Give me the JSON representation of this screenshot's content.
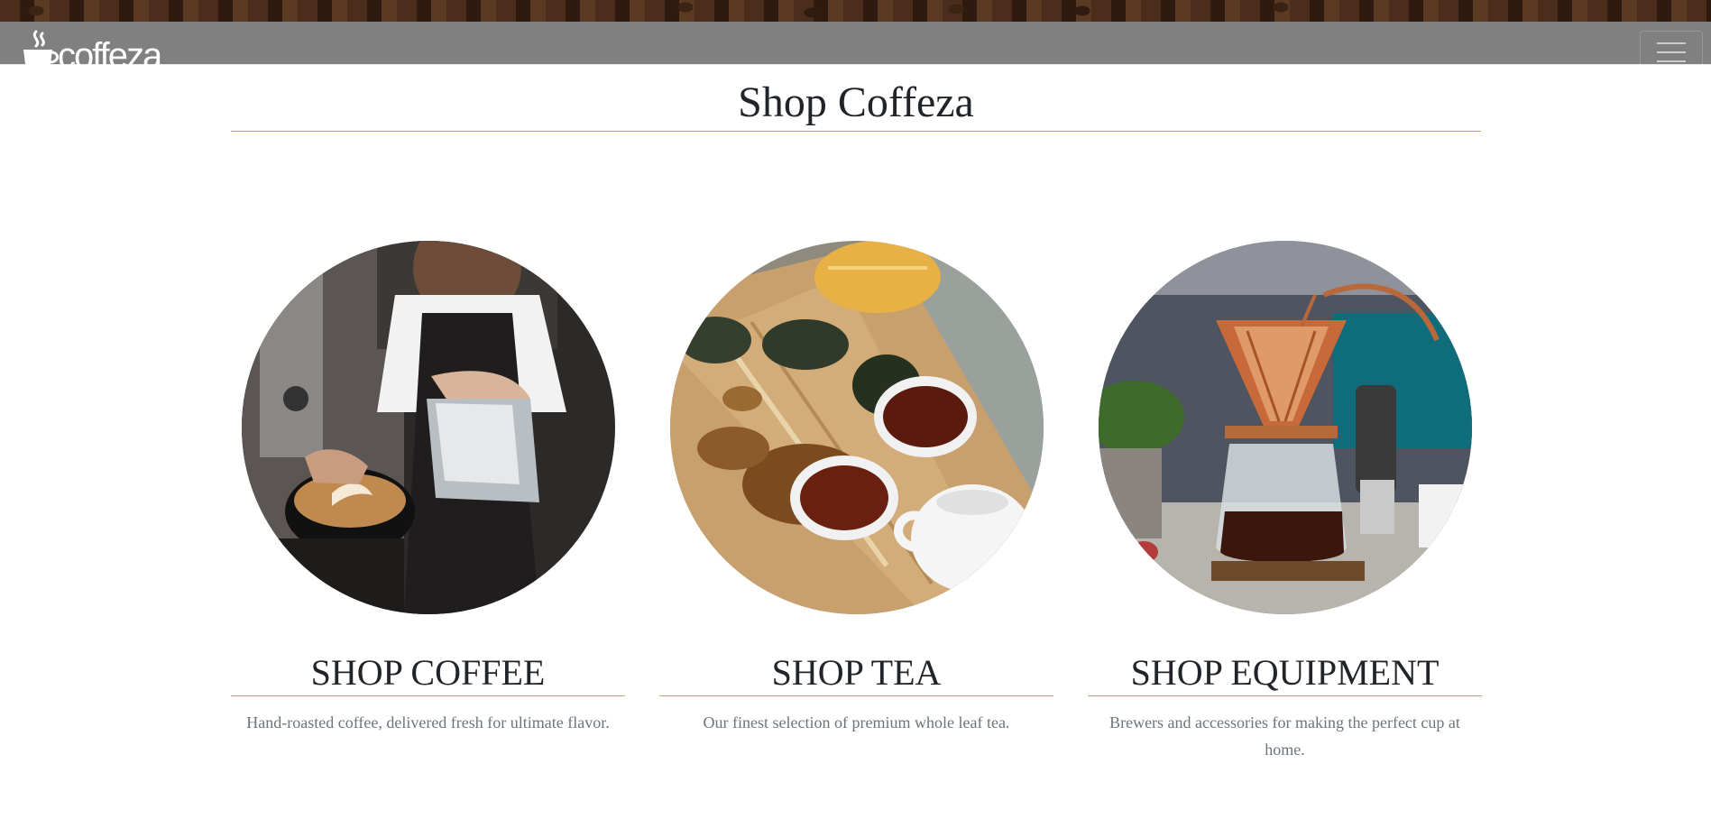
{
  "navbar": {
    "logo_text": "coffeza",
    "menu_icon": "hamburger-icon"
  },
  "page": {
    "title": "Shop Coffeza"
  },
  "cards": [
    {
      "title": "SHOP COFFEE",
      "description": "Hand-roasted coffee, delivered fresh for ultimate flavor.",
      "image": "barista-latte-art-photo"
    },
    {
      "title": "SHOP TEA",
      "description": "Our finest selection of premium whole leaf tea.",
      "image": "loose-leaf-tea-cups-photo"
    },
    {
      "title": "SHOP EQUIPMENT",
      "description": "Brewers and accessories for making the perfect cup at home.",
      "image": "pour-over-coffee-brewer-photo"
    }
  ],
  "colors": {
    "navbar_bg": "#808080",
    "accent_rule": "#c9a35d",
    "description_text": "#6c757d"
  }
}
